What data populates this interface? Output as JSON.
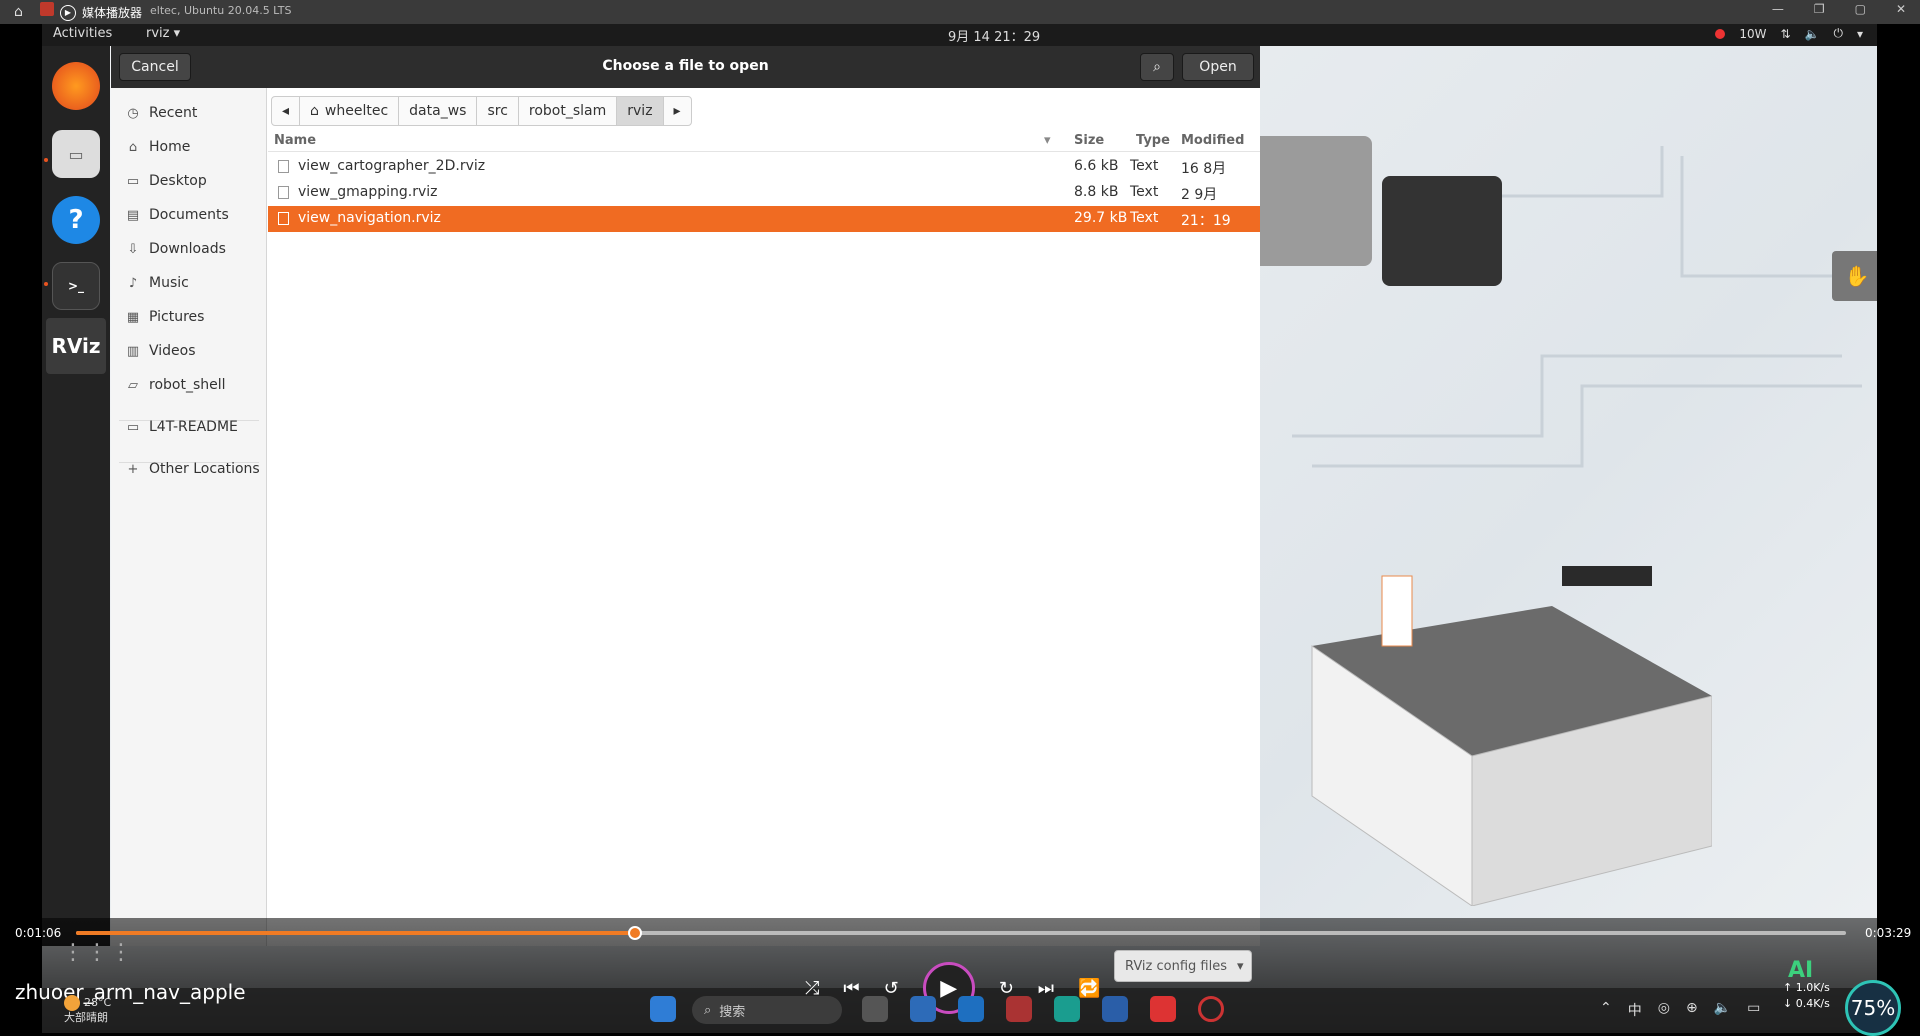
{
  "player": {
    "app_name": "媒体播放器",
    "window_subtitle": "eltec, Ubuntu 20.04.5 LTS",
    "video_title": "zhuoer_arm_nav_apple",
    "time_current": "0:01:06",
    "time_total": "0:03:29",
    "progress_fraction": 0.3158
  },
  "gnome": {
    "activities": "Activities",
    "app_menu": "rviz",
    "clock": "9月 14 21：29",
    "power": "10W"
  },
  "dialog": {
    "title": "Choose a file to open",
    "cancel_label": "Cancel",
    "open_label": "Open",
    "path": [
      "wheeltec",
      "data_ws",
      "src",
      "robot_slam",
      "rviz"
    ],
    "filter_label": "RViz config files"
  },
  "places": [
    {
      "label": "Recent",
      "icon": "clock-icon"
    },
    {
      "label": "Home",
      "icon": "home-icon"
    },
    {
      "label": "Desktop",
      "icon": "desktop-icon"
    },
    {
      "label": "Documents",
      "icon": "document-icon"
    },
    {
      "label": "Downloads",
      "icon": "download-icon"
    },
    {
      "label": "Music",
      "icon": "music-icon"
    },
    {
      "label": "Pictures",
      "icon": "picture-icon"
    },
    {
      "label": "Videos",
      "icon": "video-icon"
    },
    {
      "label": "robot_shell",
      "icon": "folder-icon"
    },
    {
      "label": "L4T-README",
      "icon": "drive-icon"
    },
    {
      "label": "Other Locations",
      "icon": "plus-icon"
    }
  ],
  "file_columns": {
    "name": "Name",
    "size": "Size",
    "type": "Type",
    "modified": "Modified"
  },
  "files": [
    {
      "name": "view_cartographer_2D.rviz",
      "size": "6.6 kB",
      "type": "Text",
      "modified": "16 8月"
    },
    {
      "name": "view_gmapping.rviz",
      "size": "8.8 kB",
      "type": "Text",
      "modified": "2 9月"
    },
    {
      "name": "view_navigation.rviz",
      "size": "29.7 kB",
      "type": "Text",
      "modified": "21：19"
    }
  ],
  "taskbar": {
    "search_placeholder": "搜索",
    "weather_temp": "28°C",
    "weather_desc": "大部晴朗",
    "net_up": "1.0K/s",
    "net_down": "0.4K/s",
    "battery_pct": "75%",
    "ime": "中",
    "ai_label": "AI"
  }
}
